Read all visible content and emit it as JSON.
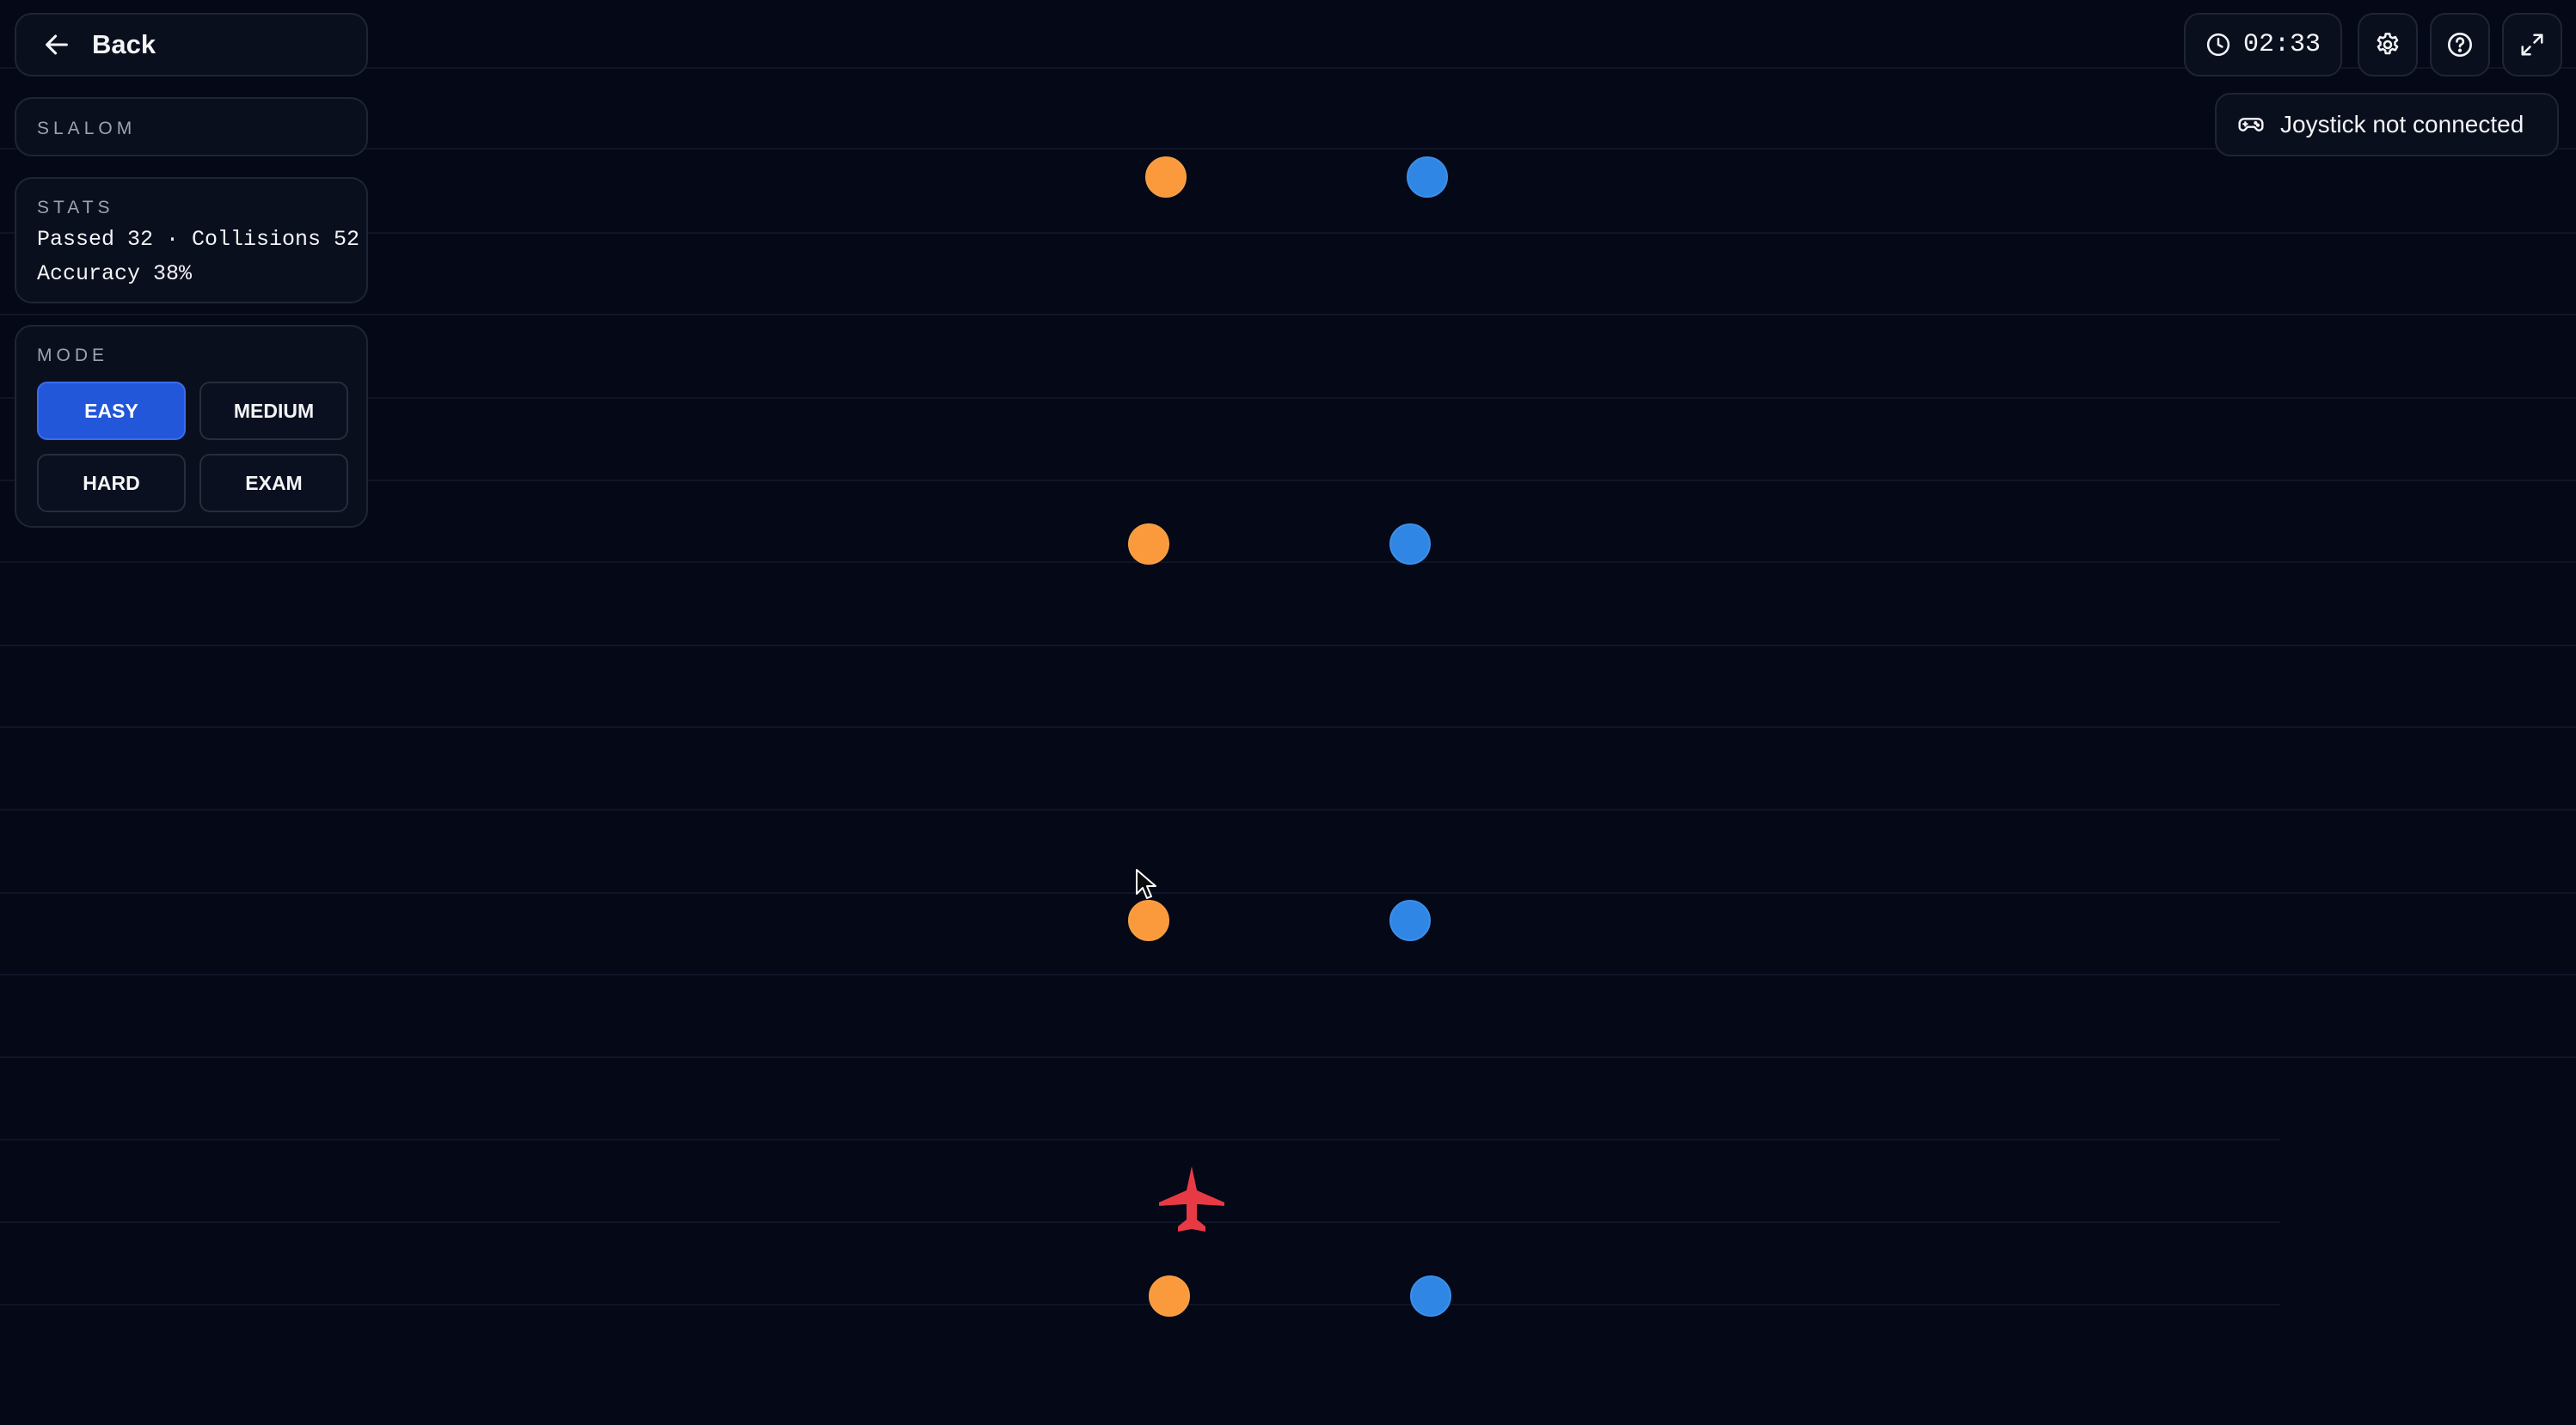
{
  "app": {
    "back_label": "Back",
    "title_label": "SLALOM"
  },
  "stats": {
    "heading": "STATS",
    "line1": "Passed 32 · Collisions 52",
    "line2": "Accuracy 38%",
    "passed": 32,
    "collisions": 52,
    "accuracy_percent": 38
  },
  "mode": {
    "heading": "MODE",
    "options": [
      "EASY",
      "MEDIUM",
      "HARD",
      "EXAM"
    ],
    "selected": "EASY"
  },
  "toolbar": {
    "timer": "02:33",
    "joystick_status": "Joystick not connected"
  },
  "icons": {
    "back": "arrow-left-icon",
    "timer": "clock-icon",
    "settings": "gear-icon",
    "help": "help-circle-icon",
    "fullscreen": "expand-icon",
    "joystick": "gamepad-icon"
  },
  "colors": {
    "background": "#050816",
    "accent": "#2357d9",
    "left_cone": "#fb9a3c",
    "right_cone": "#2f86e4",
    "player": "#e83a45"
  }
}
